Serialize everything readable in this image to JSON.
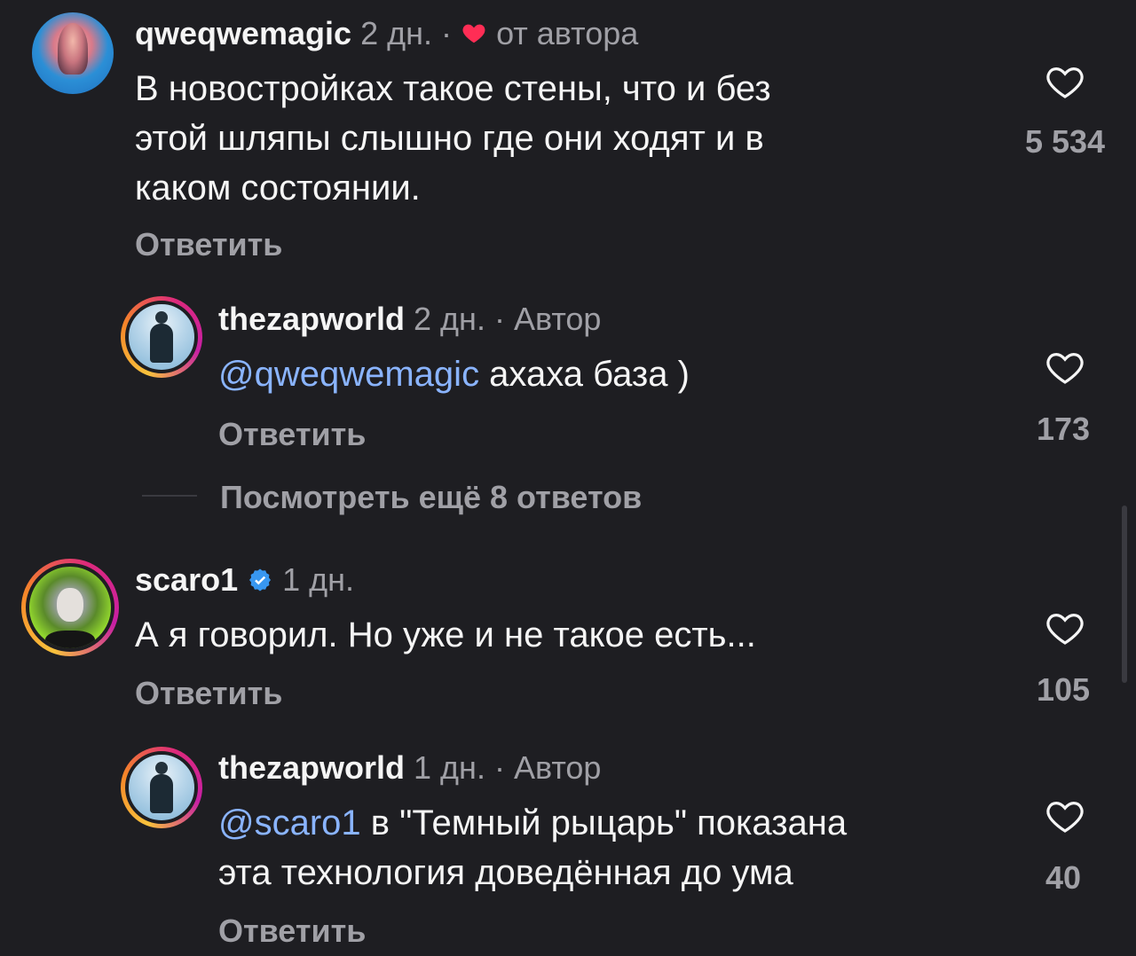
{
  "comments": [
    {
      "username": "qweqwemagic",
      "time": "2 дн.",
      "separator": "·",
      "badge": "от автора",
      "badge_icon": "red-heart-icon",
      "text_lines": [
        "В новостройках такое стены, что и без",
        "этой шляпы слышно где они ходят и в",
        "каком состоянии."
      ],
      "reply_label": "Ответить",
      "likes": "5 534"
    },
    {
      "username": "thezapworld",
      "time": "2 дн.",
      "separator": "·",
      "badge": "Автор",
      "mention": "@qweqwemagic",
      "text_lines": [
        " ахаха база )"
      ],
      "reply_label": "Ответить",
      "likes": "173"
    },
    {
      "username": "scaro1",
      "verified_icon": "verified-badge-icon",
      "time": "1 дн.",
      "text_lines": [
        "А я говорил. Но уже и не такое есть..."
      ],
      "reply_label": "Ответить",
      "likes": "105"
    },
    {
      "username": "thezapworld",
      "time": "1 дн.",
      "separator": "·",
      "badge": "Автор",
      "mention": "@scaro1",
      "text_lines": [
        " в \"Темный рыцарь\" показана",
        "эта технология доведённая до ума"
      ],
      "reply_label": "Ответить",
      "likes": "40"
    }
  ],
  "view_more_replies": "Посмотреть ещё 8 ответов",
  "colors": {
    "background": "#1e1e22",
    "text": "#f5f5f5",
    "muted": "#a0a0a6",
    "mention": "#8ab4ff",
    "heart": "#ff2d55",
    "verified": "#3897f0"
  }
}
